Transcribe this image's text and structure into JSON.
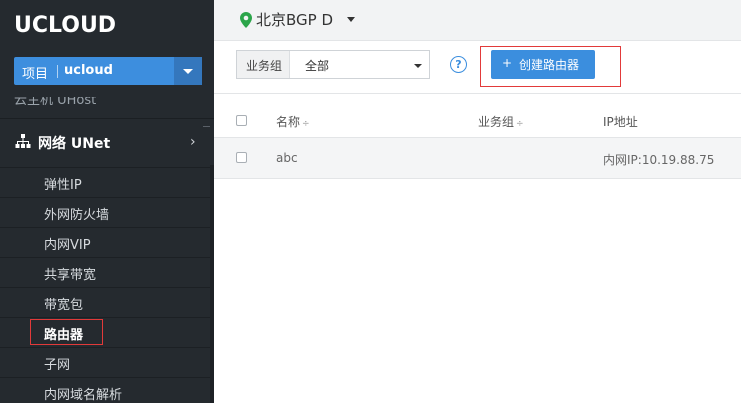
{
  "brand": {
    "logo": "UCLOUD"
  },
  "project": {
    "label": "项目",
    "value": "ucloud"
  },
  "sidebar": {
    "clipped_item": "云主机 UHost",
    "section": {
      "title": "网络 UNet"
    },
    "items": [
      {
        "label": "弹性IP"
      },
      {
        "label": "外网防火墙"
      },
      {
        "label": "内网VIP"
      },
      {
        "label": "共享带宽"
      },
      {
        "label": "带宽包"
      },
      {
        "label": "路由器"
      },
      {
        "label": "子网"
      },
      {
        "label": "内网域名解析"
      }
    ],
    "active_item": "路由器"
  },
  "topbar": {
    "region": "北京BGP D"
  },
  "filter": {
    "group_label": "业务组",
    "group_value": "全部",
    "help": "?",
    "create_button": "创建路由器",
    "create_plus": "+"
  },
  "table": {
    "columns": [
      {
        "label": "名称",
        "sort": "÷"
      },
      {
        "label": "业务组",
        "sort": "÷"
      },
      {
        "label": "IP地址"
      }
    ],
    "rows": [
      {
        "name": "abc",
        "group": "",
        "ip": "内网IP:10.19.88.75"
      }
    ]
  },
  "colors": {
    "sidebar_bg": "#252a2f",
    "accent_blue": "#3b8ede",
    "highlight_red": "#e23a3a",
    "pin_green": "#2ca54a"
  }
}
